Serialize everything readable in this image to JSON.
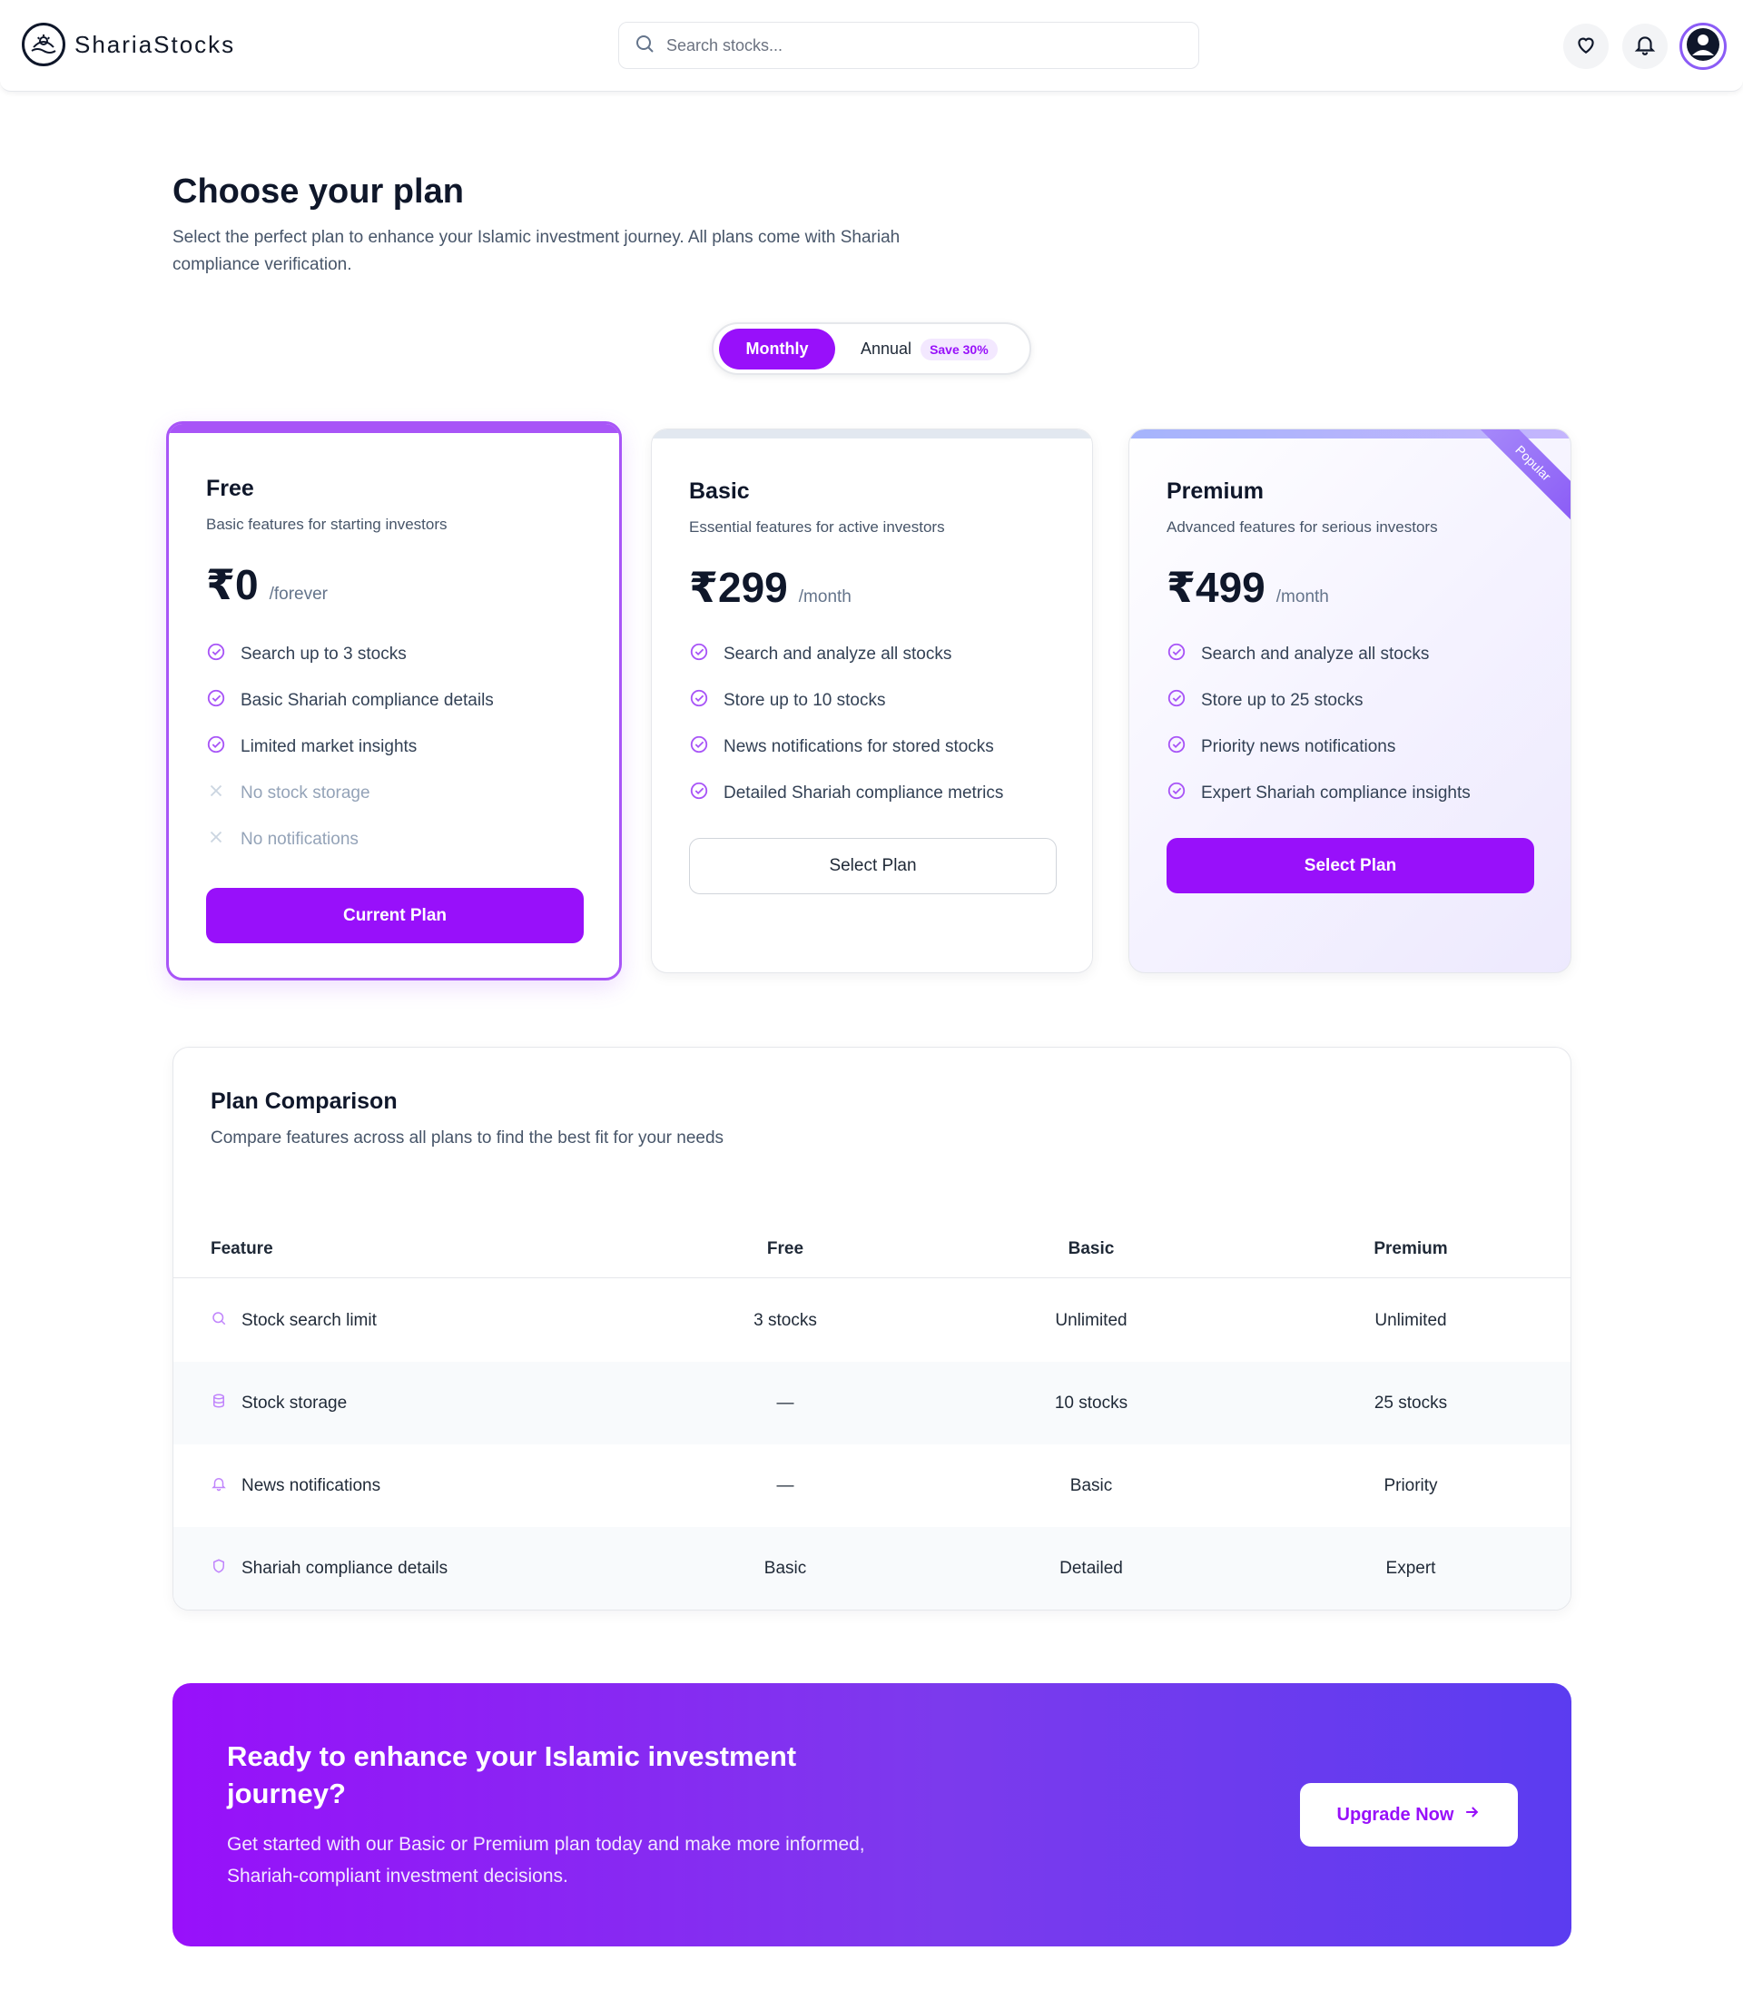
{
  "brand": {
    "name": "ShariaStocks"
  },
  "search": {
    "placeholder": "Search stocks..."
  },
  "header": {
    "icons": [
      "heart-icon",
      "bell-icon",
      "user-avatar-icon"
    ]
  },
  "hero": {
    "title": "Choose your plan",
    "subtitle": "Select the perfect plan to enhance your Islamic investment journey. All plans come with Shariah compliance verification."
  },
  "billing_toggle": {
    "monthly": "Monthly",
    "annual": "Annual",
    "save_badge": "Save 30%",
    "selected": "Monthly"
  },
  "plans": [
    {
      "name": "Free",
      "description": "Basic features for starting investors",
      "price": "₹0",
      "period": "/forever",
      "features": [
        {
          "text": "Search up to 3 stocks",
          "included": true
        },
        {
          "text": "Basic Shariah compliance details",
          "included": true
        },
        {
          "text": "Limited market insights",
          "included": true
        },
        {
          "text": "No stock storage",
          "included": false
        },
        {
          "text": "No notifications",
          "included": false
        }
      ],
      "button": "Current Plan",
      "accent": "#a855f7"
    },
    {
      "name": "Basic",
      "description": "Essential features for active investors",
      "price": "₹299",
      "period": "/month",
      "features": [
        {
          "text": "Search and analyze all stocks",
          "included": true
        },
        {
          "text": "Store up to 10 stocks",
          "included": true
        },
        {
          "text": "News notifications for stored stocks",
          "included": true
        },
        {
          "text": "Detailed Shariah compliance metrics",
          "included": true
        }
      ],
      "button": "Select Plan",
      "accent": "#e2e8f0"
    },
    {
      "name": "Premium",
      "description": "Advanced features for serious investors",
      "price": "₹499",
      "period": "/month",
      "badge": "Popular",
      "features": [
        {
          "text": "Search and analyze all stocks",
          "included": true
        },
        {
          "text": "Store up to 25 stocks",
          "included": true
        },
        {
          "text": "Priority news notifications",
          "included": true
        },
        {
          "text": "Expert Shariah compliance insights",
          "included": true
        }
      ],
      "button": "Select Plan",
      "accent": "#a5b4fc"
    }
  ],
  "comparison": {
    "title": "Plan Comparison",
    "subtitle": "Compare features across all plans to find the best fit for your needs",
    "headers": [
      "Feature",
      "Free",
      "Basic",
      "Premium"
    ],
    "rows": [
      {
        "icon": "search-icon",
        "feature": "Stock search limit",
        "free": "3 stocks",
        "basic": "Unlimited",
        "premium": "Unlimited"
      },
      {
        "icon": "database-icon",
        "feature": "Stock storage",
        "free": "—",
        "basic": "10 stocks",
        "premium": "25 stocks"
      },
      {
        "icon": "bell-icon",
        "feature": "News notifications",
        "free": "—",
        "basic": "Basic",
        "premium": "Priority"
      },
      {
        "icon": "shield-icon",
        "feature": "Shariah compliance details",
        "free": "Basic",
        "basic": "Detailed",
        "premium": "Expert"
      }
    ]
  },
  "cta": {
    "title": "Ready to enhance your Islamic investment journey?",
    "subtitle": "Get started with our Basic or Premium plan today and make more informed, Shariah-compliant investment decisions.",
    "button": "Upgrade Now"
  },
  "colors": {
    "primary": "#9810fa",
    "check": "#a855f7",
    "text": "#0f172a",
    "muted": "#475569"
  }
}
